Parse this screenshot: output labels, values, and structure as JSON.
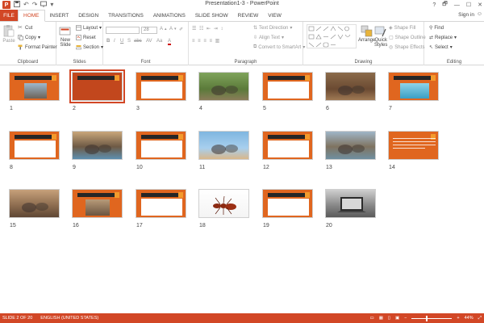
{
  "window": {
    "title": "Presentation1-3 - PowerPoint",
    "app_letter": "P",
    "help": "?",
    "controls": [
      "🗗",
      "—",
      "☐",
      "✕"
    ]
  },
  "tabs": {
    "file": "FILE",
    "items": [
      "HOME",
      "INSERT",
      "DESIGN",
      "TRANSITIONS",
      "ANIMATIONS",
      "SLIDE SHOW",
      "REVIEW",
      "VIEW"
    ],
    "active": "HOME",
    "sign_in": "Sign in",
    "feedback": "☺"
  },
  "ribbon": {
    "clipboard": {
      "label": "Clipboard",
      "paste": "Paste",
      "cut": "Cut",
      "copy": "Copy",
      "format_painter": "Format Painter"
    },
    "slides": {
      "label": "Slides",
      "new_slide": "New",
      "new_slide2": "Slide",
      "layout": "Layout",
      "reset": "Reset",
      "section": "Section"
    },
    "font": {
      "label": "Font",
      "font_size": "28"
    },
    "paragraph": {
      "label": "Paragraph",
      "text_direction": "Text Direction",
      "align_text": "Align Text",
      "convert_smartart": "Convert to SmartArt"
    },
    "drawing": {
      "label": "Drawing",
      "arrange": "Arrange",
      "quick_styles": "Quick",
      "quick_styles2": "Styles",
      "shape_fill": "Shape Fill",
      "shape_outline": "Shape Outline",
      "shape_effects": "Shape Effects"
    },
    "editing": {
      "label": "Editing",
      "find": "Find",
      "replace": "Replace",
      "select": "Select"
    }
  },
  "slides": [
    {
      "n": "1",
      "kind": "title-photo"
    },
    {
      "n": "2",
      "kind": "red-text"
    },
    {
      "n": "3",
      "kind": "text"
    },
    {
      "n": "4",
      "kind": "photo-green"
    },
    {
      "n": "5",
      "kind": "text"
    },
    {
      "n": "6",
      "kind": "photo-brown"
    },
    {
      "n": "7",
      "kind": "text-photo-blue"
    },
    {
      "n": "8",
      "kind": "text-box"
    },
    {
      "n": "9",
      "kind": "photo-water"
    },
    {
      "n": "10",
      "kind": "text"
    },
    {
      "n": "11",
      "kind": "photo-sky"
    },
    {
      "n": "12",
      "kind": "text"
    },
    {
      "n": "13",
      "kind": "photo-herd"
    },
    {
      "n": "14",
      "kind": "orange-text"
    },
    {
      "n": "15",
      "kind": "photo-tusk"
    },
    {
      "n": "16",
      "kind": "text-photo"
    },
    {
      "n": "17",
      "kind": "text"
    },
    {
      "n": "18",
      "kind": "photo-ant"
    },
    {
      "n": "19",
      "kind": "text"
    },
    {
      "n": "20",
      "kind": "photo-laptop"
    }
  ],
  "status": {
    "slide_of": "SLIDE 2 OF 20",
    "language": "ENGLISH (UNITED STATES)",
    "zoom": "44%"
  },
  "colors": {
    "accent": "#d24726",
    "slide_orange": "#e0661f",
    "slide_dark": "#262626"
  }
}
